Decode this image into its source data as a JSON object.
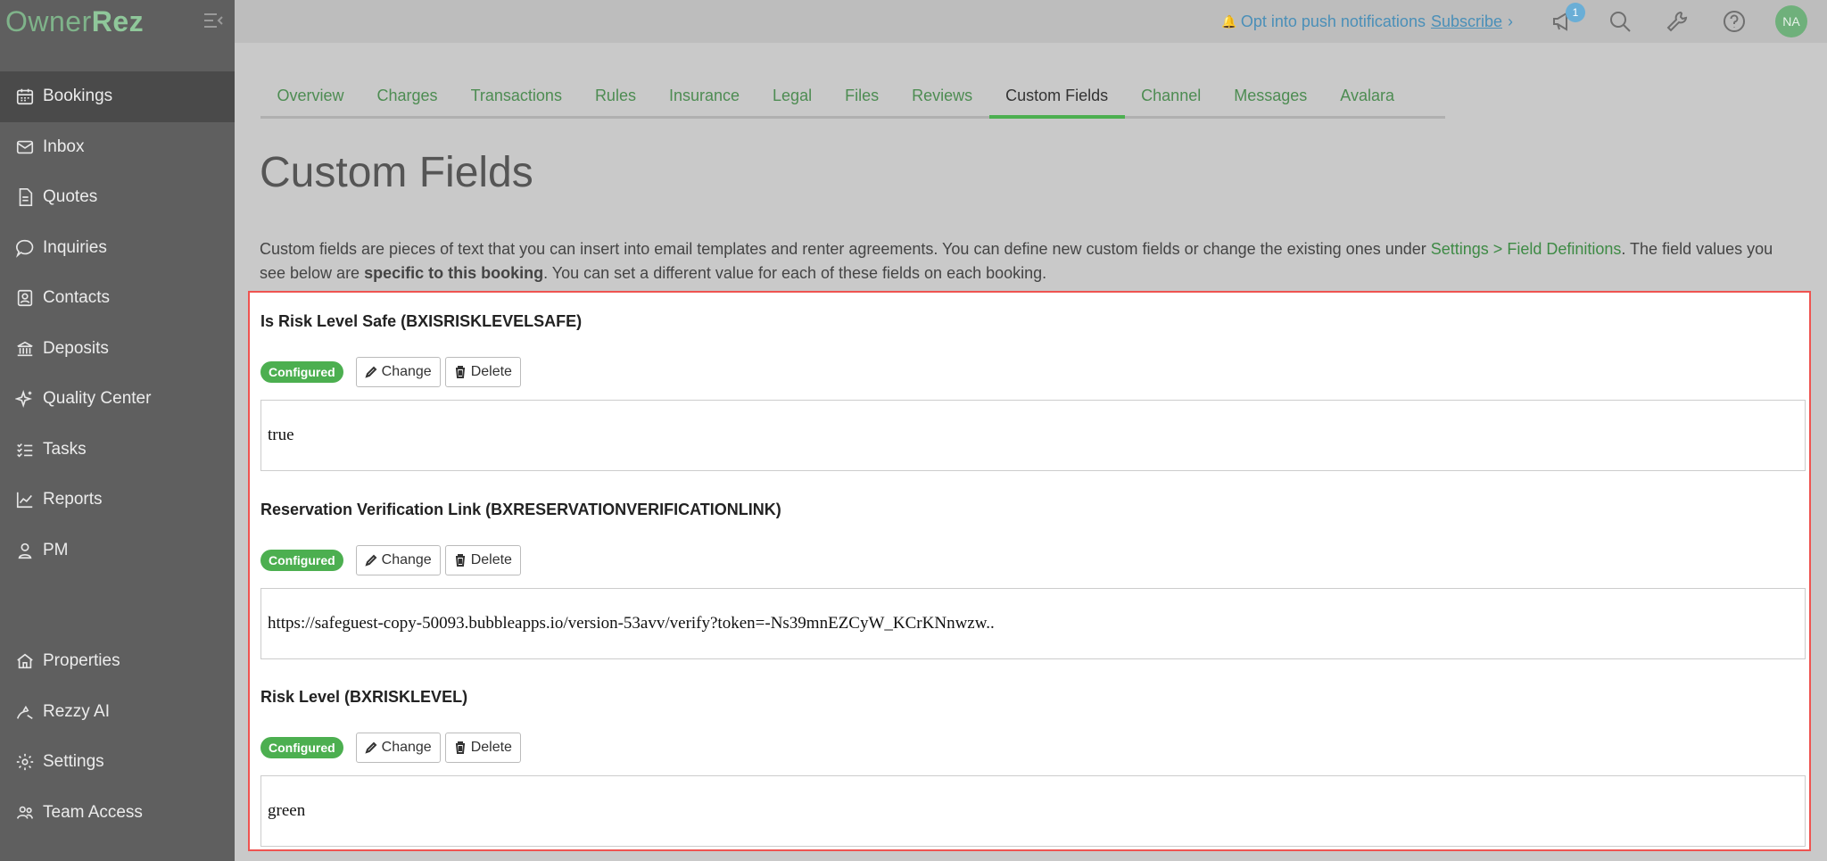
{
  "app": {
    "logo_owner": "Owner",
    "logo_rez": "Rez"
  },
  "sidebar": {
    "top_items": [
      {
        "label": "Bookings",
        "icon": "calendar-icon"
      },
      {
        "label": "Inbox",
        "icon": "envelope-icon"
      },
      {
        "label": "Quotes",
        "icon": "document-icon"
      },
      {
        "label": "Inquiries",
        "icon": "chat-icon"
      },
      {
        "label": "Contacts",
        "icon": "contact-card-icon"
      },
      {
        "label": "Deposits",
        "icon": "bank-icon"
      },
      {
        "label": "Quality Center",
        "icon": "sparkle-icon"
      },
      {
        "label": "Tasks",
        "icon": "checklist-icon"
      },
      {
        "label": "Reports",
        "icon": "chart-line-icon"
      },
      {
        "label": "PM",
        "icon": "person-icon"
      }
    ],
    "bottom_items": [
      {
        "label": "Properties",
        "icon": "house-icon"
      },
      {
        "label": "Rezzy AI",
        "icon": "ai-icon"
      },
      {
        "label": "Settings",
        "icon": "gear-icon"
      },
      {
        "label": "Team Access",
        "icon": "team-icon"
      }
    ]
  },
  "topbar": {
    "push_text": "Opt into push notifications",
    "subscribe": "Subscribe",
    "chevron": "›",
    "notification_count": "1",
    "avatar_initials": "NA"
  },
  "tabs": [
    "Overview",
    "Charges",
    "Transactions",
    "Rules",
    "Insurance",
    "Legal",
    "Files",
    "Reviews",
    "Custom Fields",
    "Channel",
    "Messages",
    "Avalara"
  ],
  "active_tab": "Custom Fields",
  "page": {
    "title": "Custom Fields",
    "desc_part1": "Custom fields are pieces of text that you can insert into email templates and renter agreements.  You can define new custom fields or change the existing ones under ",
    "desc_link": "Settings > Field Definitions",
    "desc_part2": ".  The field values you see below are ",
    "desc_bold": "specific to this booking",
    "desc_part3": ".  You can set a different value for each of these fields on each booking."
  },
  "fields": [
    {
      "title": "Is Risk Level Safe (BXISRISKLEVELSAFE)",
      "status": "Configured",
      "change": "Change",
      "delete": "Delete",
      "value": "true"
    },
    {
      "title": "Reservation Verification Link (BXRESERVATIONVERIFICATIONLINK)",
      "status": "Configured",
      "change": "Change",
      "delete": "Delete",
      "value": "https://safeguest-copy-50093.bubbleapps.io/version-53avv/verify?token=-Ns39mnEZCyW_KCrKNnwzw.."
    },
    {
      "title": "Risk Level (BXRISKLEVEL)",
      "status": "Configured",
      "change": "Change",
      "delete": "Delete",
      "value": "green"
    }
  ]
}
